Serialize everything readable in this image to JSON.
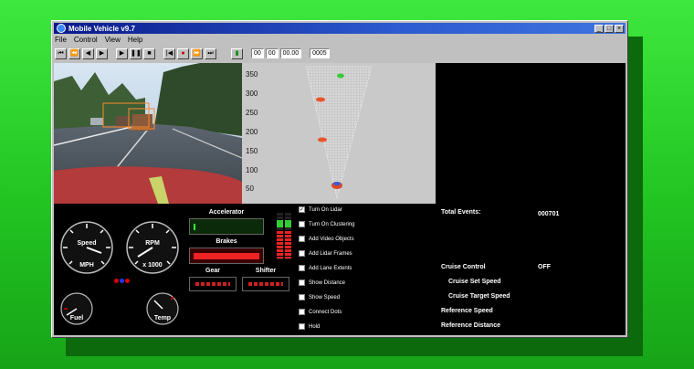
{
  "window": {
    "title": "Mobile Vehicle v9.7"
  },
  "menu": [
    "File",
    "Control",
    "View",
    "Help"
  ],
  "toolbar": {
    "time_fields": [
      "00",
      "00",
      "00.00"
    ],
    "frame": "0005"
  },
  "radar": {
    "y_ticks": [
      "350",
      "300",
      "250",
      "200",
      "150",
      "100",
      "50"
    ]
  },
  "gauges": {
    "speed": {
      "label": "Speed",
      "unit": "MPH"
    },
    "rpm": {
      "label": "RPM",
      "unit": "x 1000"
    },
    "fuel": {
      "label": "Fuel"
    },
    "temp": {
      "label": "Temp"
    }
  },
  "panels": {
    "accelerator": "Accelerator",
    "brakes": "Brakes",
    "gear": "Gear",
    "shifter": "Shifter"
  },
  "options": [
    {
      "label": "Turn On Lidar",
      "checked": true
    },
    {
      "label": "Turn On Clustering",
      "checked": false
    },
    {
      "label": "Add Video Objects",
      "checked": false
    },
    {
      "label": "Add Lidar Frames",
      "checked": false
    },
    {
      "label": "Add Lane Extents",
      "checked": false
    },
    {
      "label": "Show Distance",
      "checked": false
    },
    {
      "label": "Show Speed",
      "checked": false
    },
    {
      "label": "Connect Dots",
      "checked": false
    },
    {
      "label": "Hold",
      "checked": false
    }
  ],
  "info": {
    "total_events_label": "Total Events:",
    "total_events_value": "000701",
    "cruise_control_label": "Cruise Control",
    "cruise_control_value": "OFF",
    "cruise_set_speed_label": "Cruise Set Speed",
    "cruise_target_speed_label": "Cruise Target Speed",
    "reference_speed_label": "Reference Speed",
    "reference_distance_label": "Reference Distance"
  }
}
